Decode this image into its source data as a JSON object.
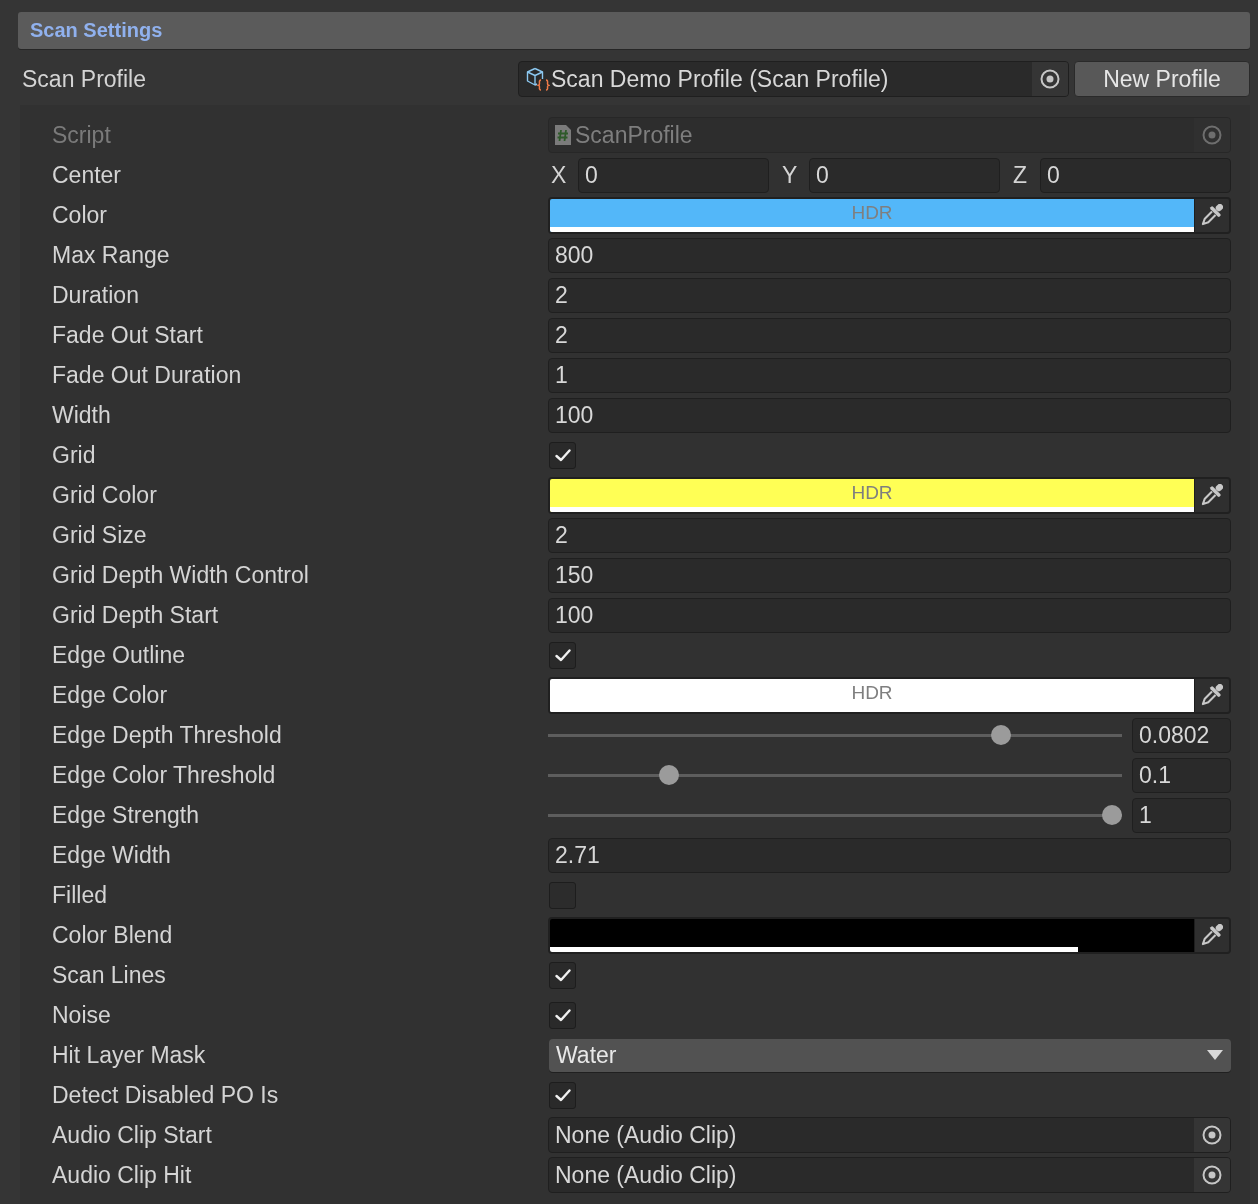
{
  "header": {
    "title": "Scan Settings"
  },
  "profile": {
    "label": "Scan Profile",
    "value": "Scan Demo Profile (Scan Profile)",
    "button": "New Profile"
  },
  "properties": [
    {
      "label": "Script",
      "kind": "script",
      "value": "ScanProfile",
      "disabled": true
    },
    {
      "label": "Center",
      "kind": "vector3",
      "components": [
        {
          "axis": "X",
          "value": "0"
        },
        {
          "axis": "Y",
          "value": "0"
        },
        {
          "axis": "Z",
          "value": "0"
        }
      ],
      "disabled": false
    },
    {
      "label": "Color",
      "kind": "color",
      "color": "#53b7f9",
      "level": 1,
      "hdr": "HDR",
      "disabled": false
    },
    {
      "label": "Max Range",
      "kind": "number",
      "value": "800",
      "disabled": false
    },
    {
      "label": "Duration",
      "kind": "number",
      "value": "2",
      "disabled": false
    },
    {
      "label": "Fade Out Start",
      "kind": "number",
      "value": "2",
      "disabled": false
    },
    {
      "label": "Fade Out Duration",
      "kind": "number",
      "value": "1",
      "disabled": false
    },
    {
      "label": "Width",
      "kind": "number",
      "value": "100",
      "disabled": false
    },
    {
      "label": "Grid",
      "kind": "checkbox",
      "checked": true,
      "disabled": false
    },
    {
      "label": "Grid Color",
      "kind": "color",
      "color": "#ffff55",
      "level": 1,
      "hdr": "HDR",
      "disabled": false
    },
    {
      "label": "Grid Size",
      "kind": "number",
      "value": "2",
      "disabled": false
    },
    {
      "label": "Grid Depth Width Control",
      "kind": "number",
      "value": "150",
      "disabled": false
    },
    {
      "label": "Grid Depth Start",
      "kind": "number",
      "value": "100",
      "disabled": false
    },
    {
      "label": "Edge Outline",
      "kind": "checkbox",
      "checked": true,
      "disabled": false
    },
    {
      "label": "Edge Color",
      "kind": "color",
      "color": "#ffffff",
      "level": 1,
      "hdr": "HDR",
      "disabled": false
    },
    {
      "label": "Edge Depth Threshold",
      "kind": "slider",
      "level": 0.8,
      "value": "0.0802",
      "disabled": false
    },
    {
      "label": "Edge Color Threshold",
      "kind": "slider",
      "level": 0.2,
      "value": "0.1",
      "disabled": false
    },
    {
      "label": "Edge Strength",
      "kind": "slider",
      "level": 1,
      "value": "1",
      "disabled": false
    },
    {
      "label": "Edge Width",
      "kind": "number",
      "value": "2.71",
      "disabled": false
    },
    {
      "label": "Filled",
      "kind": "checkbox",
      "checked": false,
      "disabled": false
    },
    {
      "label": "Color Blend",
      "kind": "color",
      "color": "#000000",
      "level": 0.82,
      "disabled": false
    },
    {
      "label": "Scan Lines",
      "kind": "checkbox",
      "checked": true,
      "disabled": false
    },
    {
      "label": "Noise",
      "kind": "checkbox",
      "checked": true,
      "disabled": false
    },
    {
      "label": "Hit Layer Mask",
      "kind": "dropdown",
      "value": "Water",
      "disabled": false
    },
    {
      "label": "Detect Disabled PO Is",
      "kind": "checkbox",
      "checked": true,
      "disabled": false
    },
    {
      "label": "Audio Clip Start",
      "kind": "object",
      "value": "None (Audio Clip)",
      "disabled": false
    },
    {
      "label": "Audio Clip Hit",
      "kind": "object",
      "value": "None (Audio Clip)",
      "disabled": false
    }
  ]
}
